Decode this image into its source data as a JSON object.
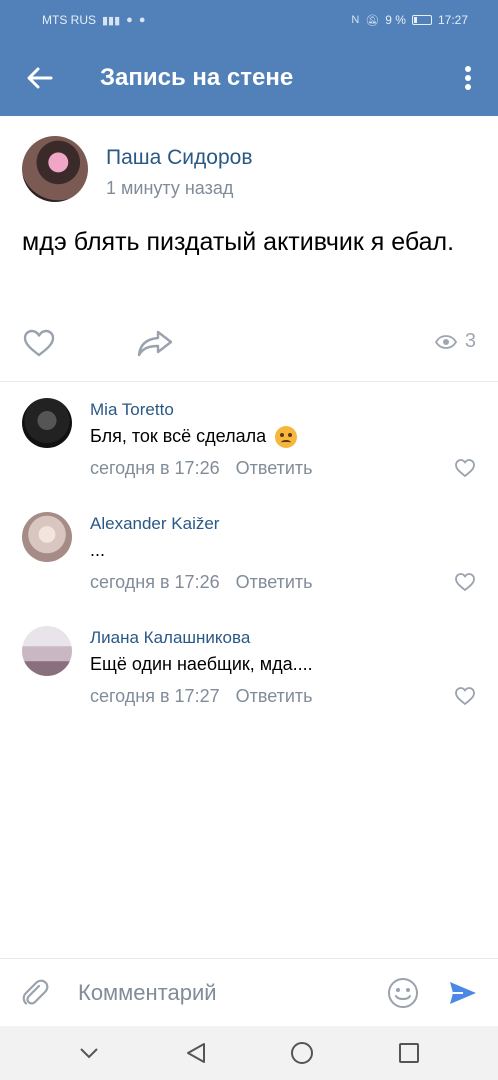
{
  "status_bar": {
    "carrier": "MTS RUS",
    "battery": "9 %",
    "time": "17:27"
  },
  "toolbar": {
    "title": "Запись на стене"
  },
  "post": {
    "author": "Паша Сидоров",
    "time": "1 минуту назад",
    "text": "мдэ блять пиздатый активчик я ебал.",
    "views": "3"
  },
  "comments": [
    {
      "author": "Mia Toretto",
      "text": "Бля, ток всё сделала",
      "time": "сегодня в 17:26",
      "reply": "Ответить",
      "emoji": "angry-face"
    },
    {
      "author": "Alexander Kaižer",
      "text": "...",
      "time": "сегодня в 17:26",
      "reply": "Ответить"
    },
    {
      "author": "Лиана Калашникова",
      "text": "Ещё один наебщик, мда....",
      "time": "сегодня в 17:27",
      "reply": "Ответить"
    }
  ],
  "composer": {
    "placeholder": "Комментарий"
  },
  "colors": {
    "header": "#5181b8",
    "link": "#2a5885",
    "secondary": "#818c99",
    "send": "#4a8ae6"
  }
}
